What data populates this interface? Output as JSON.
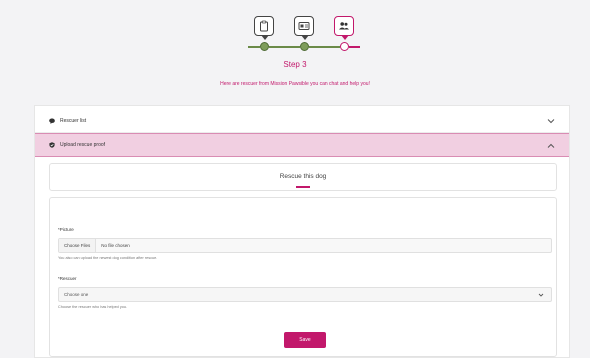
{
  "stepper": {
    "steps": [
      {
        "icon": "clipboard-icon",
        "state": "done"
      },
      {
        "icon": "id-card-icon",
        "state": "done"
      },
      {
        "icon": "users-icon",
        "state": "active"
      }
    ],
    "colors": {
      "done": "#7d9c5a",
      "active": "#c2186b"
    }
  },
  "header": {
    "step_title": "Step 3",
    "step_subtitle": "Here are rescuer from Mission Pawsible you can chat and help you!"
  },
  "accordion": {
    "items": [
      {
        "label": "Rescuer list",
        "icon": "chat-bubble-icon",
        "expanded": false
      },
      {
        "label": "Upload rescue proof",
        "icon": "shield-icon",
        "expanded": true
      }
    ]
  },
  "tab": {
    "label": "Rescue this dog"
  },
  "form": {
    "picture": {
      "label": "*Picture",
      "button": "Choose Files",
      "status": "No file chosen",
      "help": "You also can upload the newest dog condition after rescue."
    },
    "rescuer": {
      "label": "*Rescuer",
      "value": "Choose one",
      "help": "Choose the rescuer who has helped you."
    },
    "save_label": "Save"
  },
  "theme": {
    "accent": "#c2186b",
    "highlight": "#f1cfe1"
  }
}
